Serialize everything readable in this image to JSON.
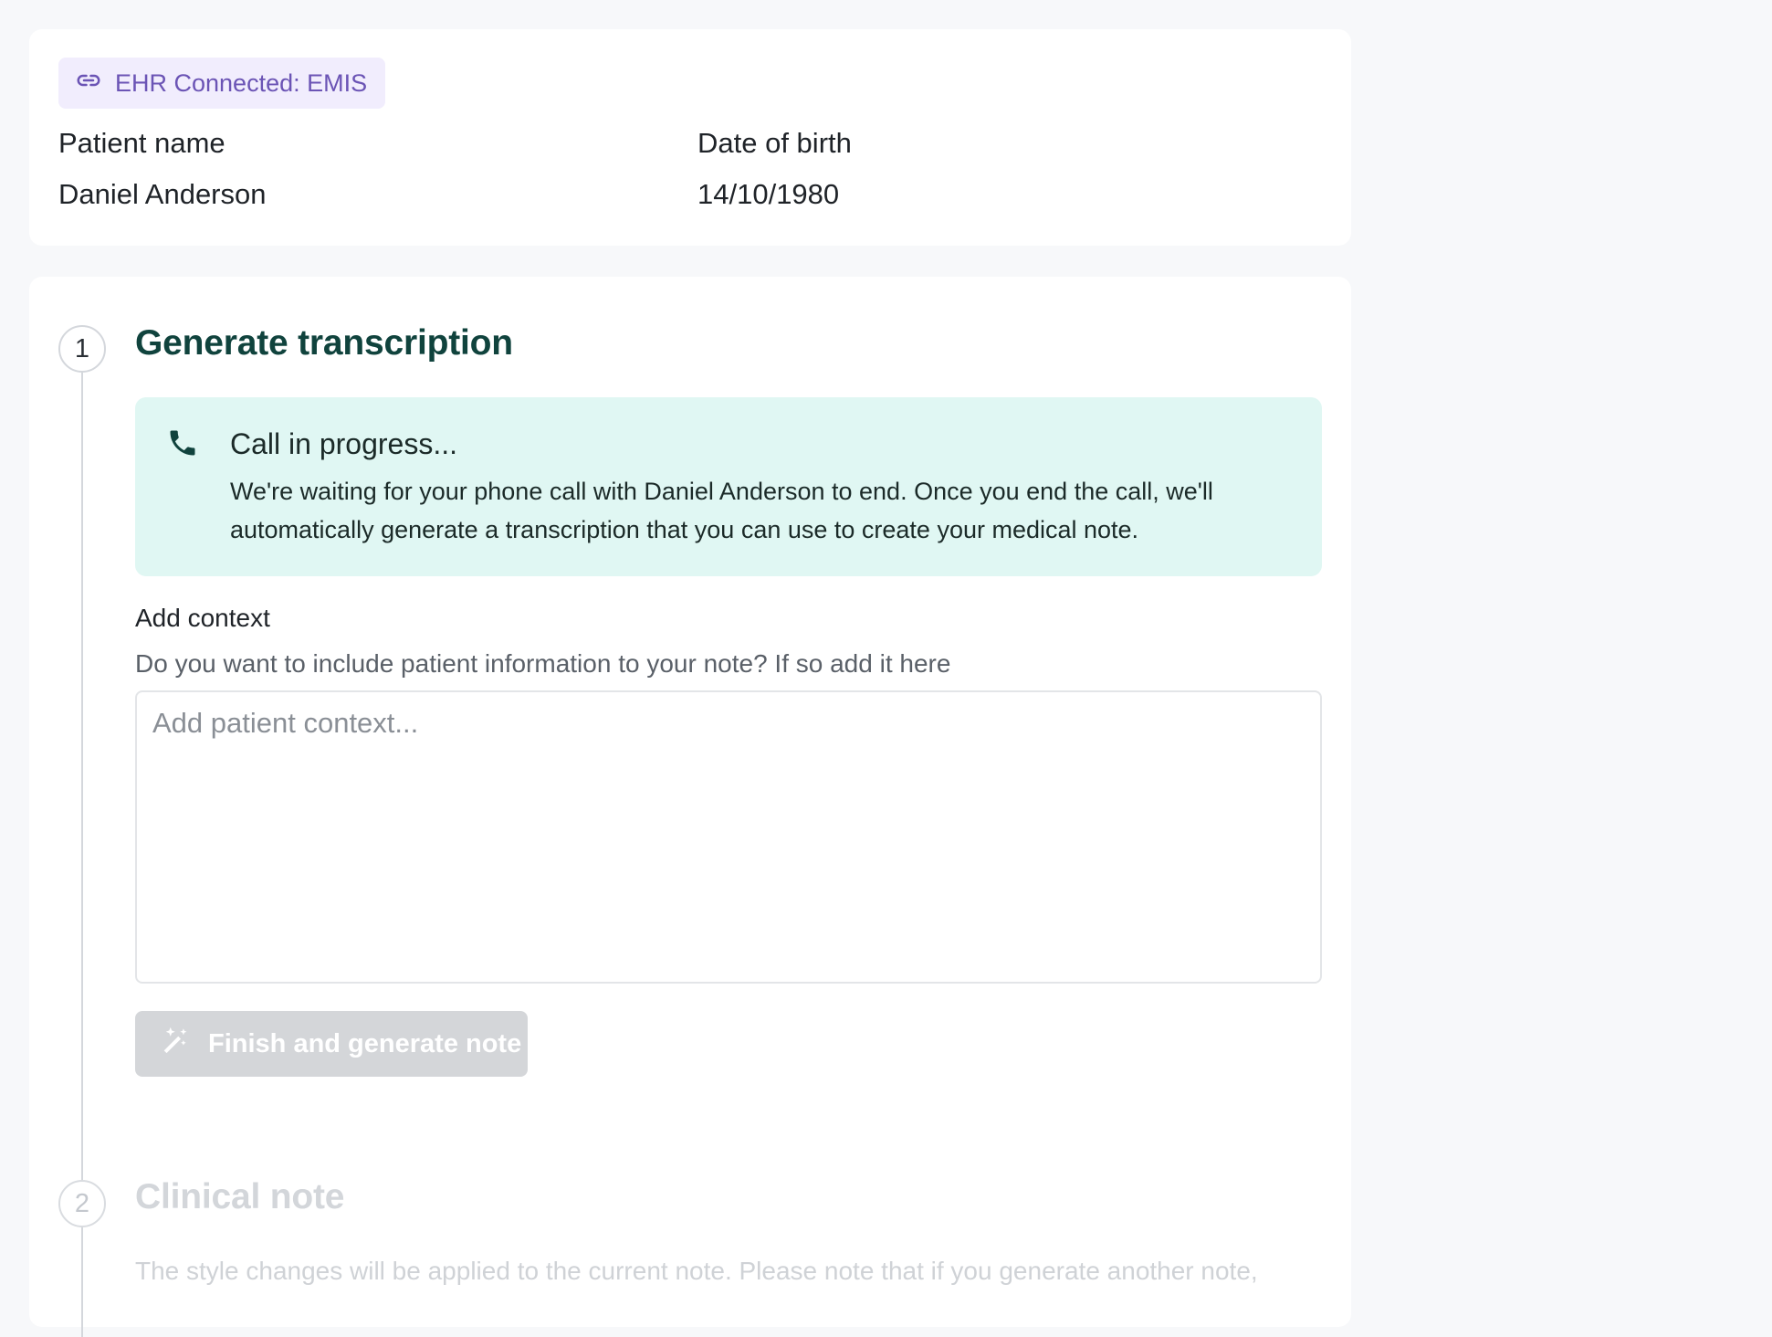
{
  "patient": {
    "ehr_badge": "EHR Connected: EMIS",
    "name_label": "Patient name",
    "name_value": "Daniel Anderson",
    "dob_label": "Date of birth",
    "dob_value": "14/10/1980"
  },
  "steps": [
    {
      "number": "1",
      "title": "Generate transcription",
      "call": {
        "icon": "phone-icon",
        "title": "Call in progress...",
        "text": "We're waiting for your phone call with Daniel Anderson to end. Once you end the call, we'll automatically generate a transcription that you can use to create your medical note."
      },
      "context": {
        "label": "Add context",
        "help": "Do you want to include patient information to your note? If so add it here",
        "placeholder": "Add patient context...",
        "value": ""
      },
      "finish_button": {
        "label": "Finish and generate note",
        "icon": "magic-wand-icon",
        "enabled": false
      }
    },
    {
      "number": "2",
      "title": "Clinical note",
      "text": "The style changes will be applied to the current note. Please note that if you generate another note,"
    }
  ],
  "colors": {
    "page_bg": "#f7f8fa",
    "badge_bg": "#f1edfd",
    "badge_text": "#6b54b5",
    "step_title": "#10433d",
    "call_bg": "#e0f7f3",
    "disabled_button": "#d4d6d9"
  }
}
